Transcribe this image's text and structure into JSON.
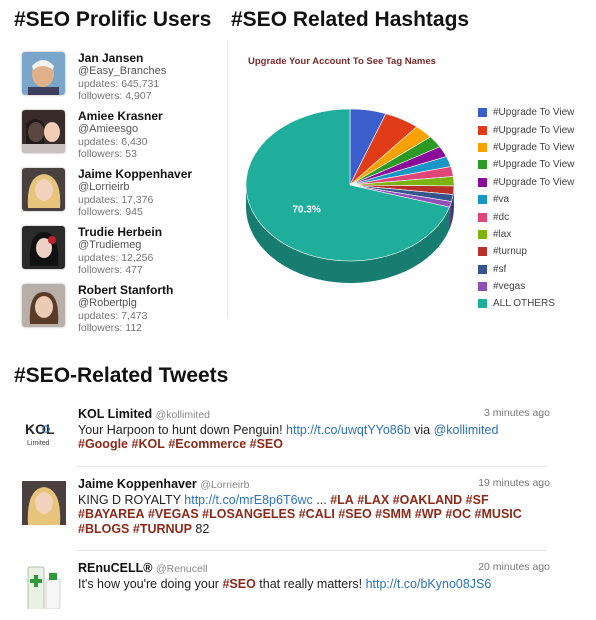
{
  "users_heading": "#SEO Prolific Users",
  "hashtags_heading": "#SEO Related Hashtags",
  "tweets_heading": "#SEO-Related Tweets",
  "users": [
    {
      "name": "Jan Jansen",
      "handle": "@Easy_Branches",
      "updates": "updates: 645,731",
      "followers": "followers: 4,907"
    },
    {
      "name": "Amiee Krasner",
      "handle": "@Amieesgo",
      "updates": "updates: 6,430",
      "followers": "followers: 53"
    },
    {
      "name": "Jaime Koppenhaver",
      "handle": "@Lorrieirb",
      "updates": "updates: 17,376",
      "followers": "followers: 945"
    },
    {
      "name": "Trudie Herbein",
      "handle": "@Trudiemeg",
      "updates": "updates: 12,256",
      "followers": "followers: 477"
    },
    {
      "name": "Robert Stanforth",
      "handle": "@Robertplg",
      "updates": "updates: 7,473",
      "followers": "followers: 112"
    }
  ],
  "chart_data": {
    "type": "pie",
    "title": "Upgrade Your Account To See Tag Names",
    "labels": [
      "#Upgrade To View",
      "#Upgrade To View",
      "#Upgrade To View",
      "#Upgrade To View",
      "#Upgrade To View",
      "#va",
      "#dc",
      "#lax",
      "#turnup",
      "#sf",
      "#vegas",
      "ALL OTHERS"
    ],
    "values": [
      5.6,
      5.5,
      3.0,
      2.5,
      2.3,
      2.2,
      2.1,
      2.0,
      1.8,
      1.5,
      1.2,
      70.3
    ],
    "colors": [
      "#3a5fcd",
      "#e03c18",
      "#f8a100",
      "#2a9a25",
      "#8a0a9a",
      "#1996c4",
      "#e0457a",
      "#7cb30f",
      "#b8302a",
      "#35558f",
      "#8f4fb5",
      "#1fae9b"
    ],
    "data_labels": [
      "",
      "",
      "",
      "",
      "",
      "",
      "",
      "",
      "",
      "",
      "",
      "70.3%"
    ],
    "legend_position": "right"
  },
  "tweets": [
    {
      "name": "KOL Limited",
      "handle": "@kollimited",
      "time": "3 minutes ago",
      "logo_main": "KOL",
      "logo_sub": "Limited",
      "parts": [
        {
          "t": "text",
          "v": "Your Harpoon to hunt down Penguin! "
        },
        {
          "t": "link",
          "v": "http://t.co/uwqtYYo86b"
        },
        {
          "t": "text",
          "v": " via "
        },
        {
          "t": "link",
          "v": "@kollimited"
        },
        {
          "t": "text",
          "v": " "
        },
        {
          "t": "tag",
          "v": "#Google"
        },
        {
          "t": "text",
          "v": " "
        },
        {
          "t": "tag",
          "v": "#KOL"
        },
        {
          "t": "text",
          "v": " "
        },
        {
          "t": "tag",
          "v": "#Ecommerce"
        },
        {
          "t": "text",
          "v": " "
        },
        {
          "t": "tag",
          "v": "#SEO"
        }
      ]
    },
    {
      "name": "Jaime Koppenhaver",
      "handle": "@Lorrieirb",
      "time": "19 minutes ago",
      "parts": [
        {
          "t": "text",
          "v": "KING D ROYALTY "
        },
        {
          "t": "link",
          "v": "http://t.co/mrE8p6T6wc"
        },
        {
          "t": "text",
          "v": " ... "
        },
        {
          "t": "tag",
          "v": "#LA"
        },
        {
          "t": "text",
          "v": " "
        },
        {
          "t": "tag",
          "v": "#LAX"
        },
        {
          "t": "text",
          "v": " "
        },
        {
          "t": "tag",
          "v": "#OAKLAND"
        },
        {
          "t": "text",
          "v": " "
        },
        {
          "t": "tag",
          "v": "#SF"
        },
        {
          "t": "text",
          "v": " "
        },
        {
          "t": "tag",
          "v": "#BAYAREA"
        },
        {
          "t": "text",
          "v": " "
        },
        {
          "t": "tag",
          "v": "#VEGAS"
        },
        {
          "t": "text",
          "v": " "
        },
        {
          "t": "tag",
          "v": "#LOSANGELES"
        },
        {
          "t": "text",
          "v": " "
        },
        {
          "t": "tag",
          "v": "#CALI"
        },
        {
          "t": "text",
          "v": " "
        },
        {
          "t": "tag",
          "v": "#SEO"
        },
        {
          "t": "text",
          "v": " "
        },
        {
          "t": "tag",
          "v": "#SMM"
        },
        {
          "t": "text",
          "v": " "
        },
        {
          "t": "tag",
          "v": "#WP"
        },
        {
          "t": "text",
          "v": " "
        },
        {
          "t": "tag",
          "v": "#OC"
        },
        {
          "t": "text",
          "v": " "
        },
        {
          "t": "tag",
          "v": "#MUSIC"
        },
        {
          "t": "text",
          "v": " "
        },
        {
          "t": "tag",
          "v": "#BLOGS"
        },
        {
          "t": "text",
          "v": " "
        },
        {
          "t": "tag",
          "v": "#TURNUP"
        },
        {
          "t": "text",
          "v": " 82"
        }
      ]
    },
    {
      "name": "REnuCELL®",
      "handle": "@Renucell",
      "time": "20 minutes ago",
      "parts": [
        {
          "t": "text",
          "v": "It's how you're doing your "
        },
        {
          "t": "tag",
          "v": "#SEO"
        },
        {
          "t": "text",
          "v": " that really matters! "
        },
        {
          "t": "link",
          "v": "http://t.co/bKyno08JS6"
        }
      ]
    }
  ]
}
